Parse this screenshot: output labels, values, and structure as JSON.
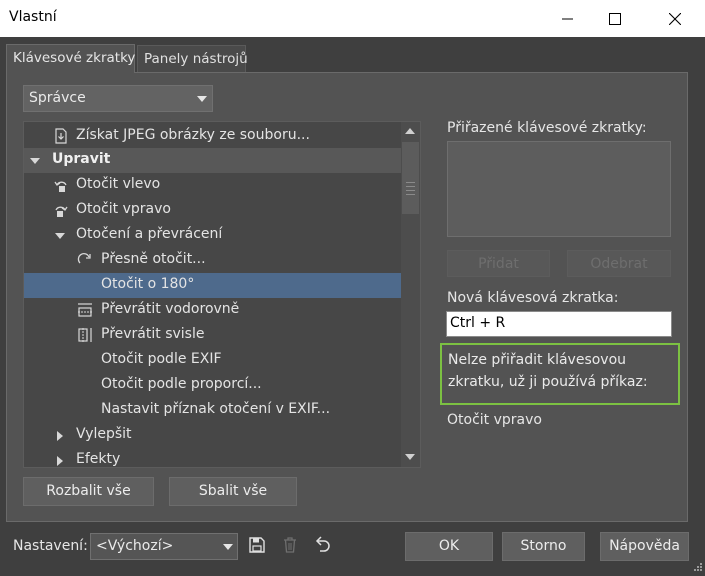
{
  "window": {
    "title": "Vlastní"
  },
  "tabs": [
    {
      "label": "Klávesové zkratky"
    },
    {
      "label": "Panely nástrojů"
    }
  ],
  "manager_select": {
    "value": "Správce"
  },
  "tree": {
    "rows": [
      {
        "label": "Získat JPEG obrázky ze souboru...",
        "icon": "import-file-icon"
      },
      {
        "label": "Upravit",
        "icon": "expand-triangle-icon"
      },
      {
        "label": "Otočit vlevo",
        "icon": "rotate-left-icon"
      },
      {
        "label": "Otočit vpravo",
        "icon": "rotate-right-icon"
      },
      {
        "label": "Otočení a převrácení",
        "icon": "expand-triangle-icon"
      },
      {
        "label": "Přesně otočit...",
        "icon": "rotate-precise-icon"
      },
      {
        "label": "Otočit o 180°",
        "icon": ""
      },
      {
        "label": "Převrátit vodorovně",
        "icon": "flip-horizontal-icon"
      },
      {
        "label": "Převrátit svisle",
        "icon": "flip-vertical-icon"
      },
      {
        "label": "Otočit podle EXIF",
        "icon": ""
      },
      {
        "label": "Otočit podle proporcí...",
        "icon": ""
      },
      {
        "label": "Nastavit příznak otočení v EXIF...",
        "icon": ""
      },
      {
        "label": "Vylepšit",
        "icon": "collapsed-triangle-icon"
      },
      {
        "label": "Efekty",
        "icon": "collapsed-triangle-icon"
      }
    ]
  },
  "buttons": {
    "expand_all": "Rozbalit vše",
    "collapse_all": "Sbalit vše",
    "add": "Přidat",
    "remove": "Odebrat",
    "ok": "OK",
    "cancel": "Storno",
    "help": "Nápověda"
  },
  "assigned_shortcuts": {
    "label": "Přiřazené klávesové zkratky:"
  },
  "new_shortcut": {
    "label": "Nová klávesová zkratka:",
    "value": "Ctrl + R"
  },
  "warning": {
    "message": "Nelze přiřadit klávesovou zkratku, už ji používá příkaz:",
    "command": "Otočit vpravo",
    "border_color": "#7cc142"
  },
  "settings": {
    "label": "Nastavení:",
    "value": "<Výchozí>"
  },
  "colors": {
    "selection": "#4e6a8c",
    "background": "#3f3f3f",
    "panel": "#535353"
  }
}
